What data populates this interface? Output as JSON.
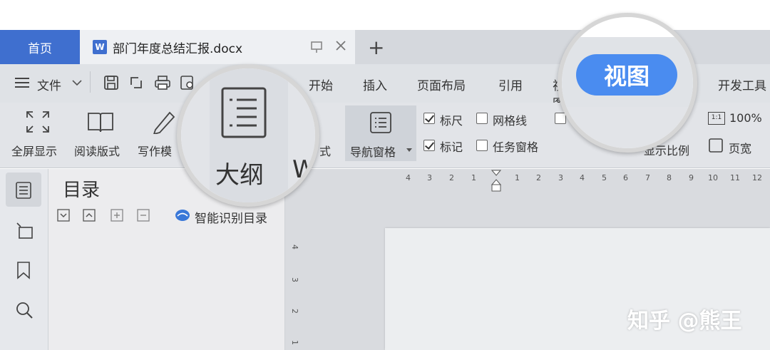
{
  "tabs": {
    "home": "首页",
    "doc_icon": "W",
    "doc_title": "部门年度总结汇报.docx",
    "new_tab": "+"
  },
  "menu": {
    "file": "文件",
    "items": [
      "开始",
      "插入",
      "页面布局",
      "引用",
      "视图",
      "开发工具"
    ]
  },
  "ribbon": {
    "fullscreen": "全屏显示",
    "reading_mode": "阅读版式",
    "writing_mode": "写作模",
    "outline": "大纲",
    "web_partial": "W",
    "web_suffix": "式",
    "nav_pane": "导航窗格",
    "ruler": "标尺",
    "gridlines": "网格线",
    "marks": "标记",
    "task_pane": "任务窗格",
    "zoom_value": "100%",
    "zoom_label": "显示比例",
    "page_width": "页宽",
    "ruler_checked": true,
    "gridlines_checked": false,
    "marks_checked": true,
    "task_pane_checked": false
  },
  "nav_panel": {
    "title": "目录",
    "smart_toc": "智能识别目录"
  },
  "ruler_h": [
    "4",
    "3",
    "2",
    "1",
    "1",
    "2",
    "3",
    "4",
    "5",
    "6",
    "7",
    "8",
    "9",
    "10",
    "11",
    "12"
  ],
  "ruler_v": [
    "4",
    "3",
    "2",
    "1"
  ],
  "magnifier": {
    "outline_label": "大纲",
    "view_pill": "视图"
  },
  "watermark": "知乎 @熊王",
  "colors": {
    "accent": "#3f6fcf",
    "view_pill": "#4a8cf0"
  }
}
